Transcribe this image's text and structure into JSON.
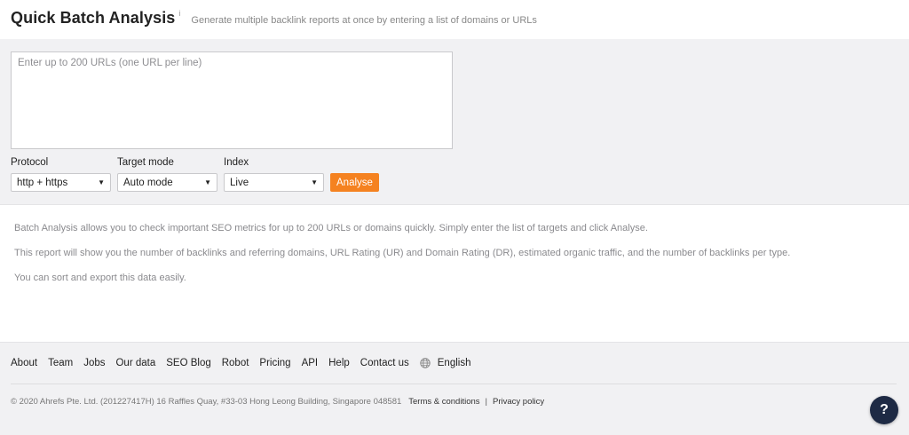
{
  "header": {
    "title": "Quick Batch Analysis",
    "info_icon": "info-icon",
    "info_glyph": "i",
    "subtitle": "Generate multiple backlink reports at once by entering a list of domains or URLs"
  },
  "form": {
    "textarea_placeholder": "Enter up to 200 URLs (one URL per line)",
    "protocol": {
      "label": "Protocol",
      "value": "http + https"
    },
    "target_mode": {
      "label": "Target mode",
      "value": "Auto mode"
    },
    "index": {
      "label": "Index",
      "value": "Live"
    },
    "analyse_label": "Analyse",
    "accent_color": "#f58220"
  },
  "description": {
    "lines": [
      "Batch Analysis allows you to check important SEO metrics for up to 200 URLs or domains quickly. Simply enter the list of targets and click Analyse.",
      "This report will show you the number of backlinks and referring domains, URL Rating (UR) and Domain Rating (DR), estimated organic traffic, and the number of backlinks per type.",
      "You can sort and export this data easily."
    ]
  },
  "footer": {
    "links": [
      "About",
      "Team",
      "Jobs",
      "Our data",
      "SEO Blog",
      "Robot",
      "Pricing",
      "API",
      "Help",
      "Contact us"
    ],
    "language": "English",
    "copyright": "© 2020 Ahrefs Pte. Ltd. (201227417H) 16 Raffles Quay, #33-03 Hong Leong Building, Singapore 048581",
    "terms": "Terms & conditions",
    "separator": "|",
    "privacy": "Privacy policy"
  },
  "help_button": {
    "label": "?",
    "color": "#1e2a44"
  }
}
